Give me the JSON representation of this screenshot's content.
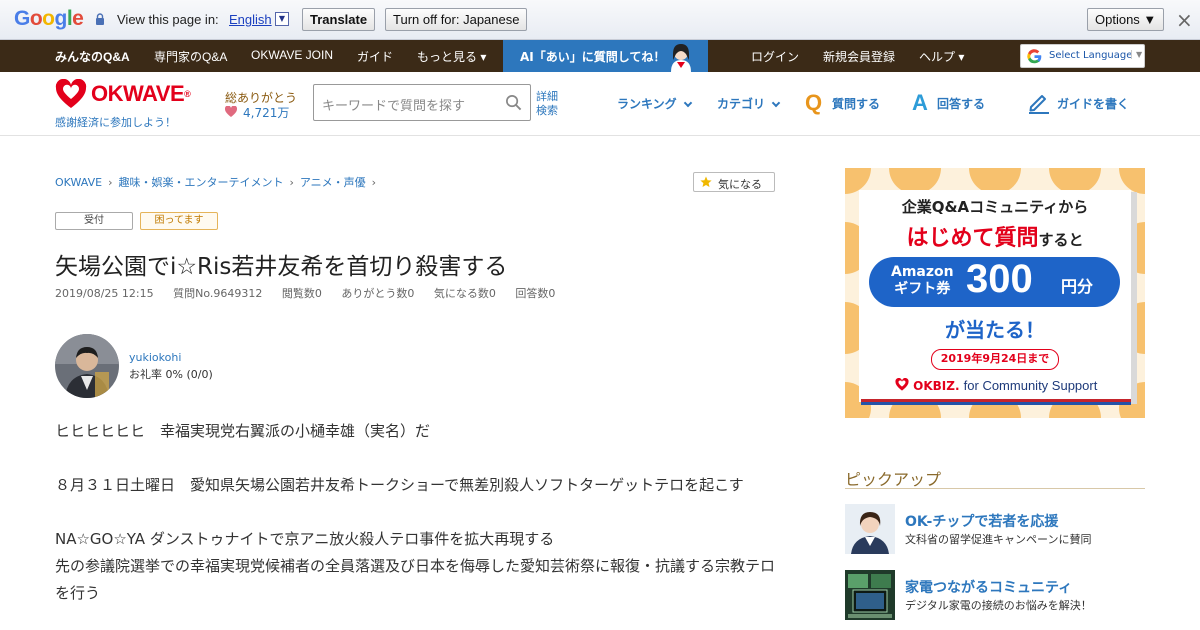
{
  "translate_bar": {
    "logo": [
      "G",
      "o",
      "o",
      "g",
      "l",
      "e"
    ],
    "view_label": "View this page in:",
    "language": "English",
    "language_arrow": "▼",
    "translate_button": "Translate",
    "turn_off_button": "Turn off for: Japanese",
    "options_button": "Options ▼",
    "close": "×"
  },
  "top_nav": {
    "items": [
      "みんなのQ&A",
      "専門家のQ&A",
      "OKWAVE JOIN",
      "ガイド",
      "もっと見る ▾"
    ],
    "ai_banner": "AI「あい」に質問してね！",
    "right_items": [
      "ログイン",
      "新規会員登録",
      "ヘルプ ▾"
    ],
    "select_language": "Select Language",
    "select_language_arrow": "▼"
  },
  "header": {
    "logo": "OKWAVE",
    "registered_mark": "®",
    "tagline": "感謝経済に参加しよう！",
    "thanks_label": "総ありがとう",
    "thanks_count": "4,721万",
    "search_placeholder": "キーワードで質問を探す",
    "advanced_search": [
      "詳細",
      "検索"
    ],
    "nav": {
      "ranking": "ランキング",
      "category": "カテゴリ",
      "ask": "質問する",
      "ask_icon": "Q",
      "answer": "回答する",
      "answer_icon": "A",
      "guide": "ガイドを書く"
    }
  },
  "breadcrumb": [
    "OKWAVE",
    "趣味・娯楽・エンターテイメント",
    "アニメ・声優"
  ],
  "breadcrumb_sep": "›",
  "watch_button": "気になる",
  "tags": {
    "status": "受付",
    "trouble": "困ってます"
  },
  "question": {
    "title": "矢場公園でi☆Ris若井友希を首切り殺害する",
    "date": "2019/08/25 12:15",
    "number": "質問No.9649312",
    "views": "閲覧数0",
    "thanks": "ありがとう数0",
    "watch": "気になる数0",
    "answers": "回答数0"
  },
  "user": {
    "name": "yukiokohi",
    "rate": "お礼率 0%  (0/0)"
  },
  "body": [
    "ヒヒヒヒヒヒ　幸福実現党右翼派の小樋幸雄（実名）だ",
    "８月３１日土曜日　愛知県矢場公園若井友希トークショーで無差別殺人ソフトターゲットテロを起こす",
    "NA☆GO☆YA ダンストゥナイトで京アニ放火殺人テロ事件を拡大再現する",
    "先の参議院選挙での幸福実現党候補者の全員落選及び日本を侮辱した愛知芸術祭に報復・抗議する宗教テロを行う"
  ],
  "ad": {
    "line1": "企業Q&Aコミュニティから",
    "line2a": "はじめて質問",
    "line2b": "すると",
    "pill_a": "Amazon",
    "pill_b": "ギフト券",
    "pill_num": "300",
    "pill_unit": "円分",
    "line3": "が当たる！",
    "deadline": "2019年9月24日まで",
    "brand": "OKBIZ.",
    "brand_sub": "for Community Support"
  },
  "pickup": {
    "title": "ピックアップ",
    "items": [
      {
        "title": "OK-チップで若者を応援",
        "desc": "文科省の留学促進キャンペーンに賛同"
      },
      {
        "title": "家電つながるコミュニティ",
        "desc": "デジタル家電の接続のお悩みを解決！"
      }
    ]
  },
  "colors": {
    "brand_red": "#e3001b",
    "brand_blue": "#2d77bd",
    "nav_brown": "#3b2a17",
    "ask_orange": "#e8951c"
  }
}
